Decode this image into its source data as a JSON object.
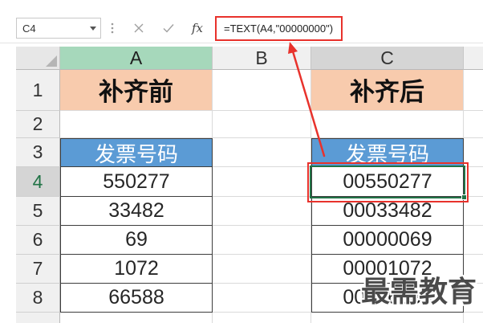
{
  "formula_bar": {
    "name_box": "C4",
    "fx_label": "fx",
    "formula": "=TEXT(A4,\"00000000\")",
    "icons": {
      "name_box_dropdown": "chevron-down-icon",
      "splitter": "vertical-dots-icon",
      "cancel": "close-icon",
      "enter": "check-icon"
    }
  },
  "sheet": {
    "columns": [
      "A",
      "B",
      "C"
    ],
    "rows": [
      "1",
      "2",
      "3",
      "4",
      "5",
      "6",
      "7",
      "8"
    ],
    "cells": {
      "A1": "补齐前",
      "C1": "补齐后",
      "A3": "发票号码",
      "C3": "发票号码",
      "A4": "550277",
      "C4": "00550277",
      "A5": "33482",
      "C5": "00033482",
      "A6": "69",
      "C6": "00000069",
      "A7": "1072",
      "C7": "00001072",
      "A8": "66588",
      "C8": "00066588"
    }
  },
  "colors": {
    "title_fill": "#f8cbad",
    "header_fill": "#5b9bd5",
    "header_text": "#ffffff",
    "selection": "#217346",
    "annotation": "#e8322c",
    "active_column": "#a6d8bb"
  },
  "watermark": "最需教育"
}
